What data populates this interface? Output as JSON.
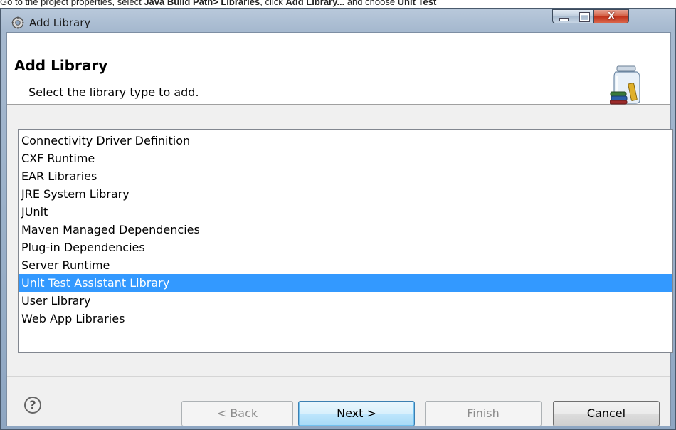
{
  "instruction": {
    "prefix": "Go to the project properties, select ",
    "bold1": "Java Build Path> Libraries",
    "mid1": ", click ",
    "bold2": "Add Library...",
    "mid2": " and choose ",
    "bold3": "Unit Test"
  },
  "window": {
    "title": "Add Library",
    "close_glyph": "X"
  },
  "header": {
    "title": "Add Library",
    "description": "Select the library type to add."
  },
  "library_types": [
    "Connectivity Driver Definition",
    "CXF Runtime",
    "EAR Libraries",
    "JRE System Library",
    "JUnit",
    "Maven Managed Dependencies",
    "Plug-in Dependencies",
    "Server Runtime",
    "Unit Test Assistant Library",
    "User Library",
    "Web App Libraries"
  ],
  "selected_index": 8,
  "footer": {
    "help_glyph": "?",
    "back_label": "< Back",
    "next_label": "Next >",
    "finish_label": "Finish",
    "cancel_label": "Cancel"
  },
  "colors": {
    "selection": "#3399ff",
    "title_gradient": "#a6b9cf"
  }
}
